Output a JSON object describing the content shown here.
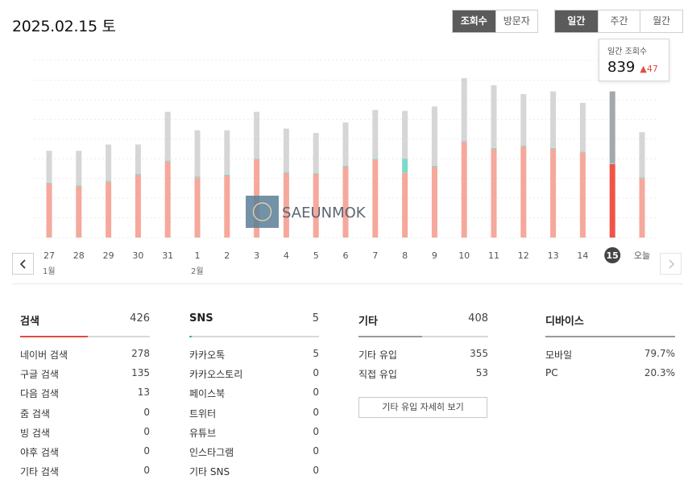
{
  "header": {
    "date": "2025.02.15 토"
  },
  "toggles": {
    "metric": [
      {
        "label": "조회수",
        "active": true
      },
      {
        "label": "방문자",
        "active": false
      }
    ],
    "period": [
      {
        "label": "일간",
        "active": true
      },
      {
        "label": "주간",
        "active": false
      },
      {
        "label": "월간",
        "active": false
      }
    ]
  },
  "tooltip": {
    "label": "일간 조회수",
    "value": "839",
    "delta": "▲47"
  },
  "watermark": "SAEUNMOK",
  "colors": {
    "search": "#f5a89c",
    "other": "#d6d6d6",
    "sns": "#7fd8cc",
    "selected_search": "#ef5448",
    "selected_other": "#a4a8ae",
    "accent_red": "#e44b3d"
  },
  "chart_data": {
    "type": "bar",
    "stacked": true,
    "categories": [
      "27",
      "28",
      "29",
      "30",
      "31",
      "1",
      "2",
      "3",
      "4",
      "5",
      "6",
      "7",
      "8",
      "9",
      "10",
      "11",
      "12",
      "13",
      "14",
      "15",
      "오늘"
    ],
    "month_labels": [
      {
        "at": "27",
        "label": "1월"
      },
      {
        "at": "1",
        "label": "2월"
      }
    ],
    "selected": "15",
    "series": [
      {
        "key": "search",
        "values": [
          305,
          290,
          315,
          355,
          430,
          340,
          350,
          440,
          365,
          360,
          400,
          440,
          365,
          400,
          540,
          500,
          515,
          500,
          480,
          415,
          335
        ]
      },
      {
        "key": "sns",
        "values": [
          5,
          5,
          5,
          5,
          5,
          5,
          5,
          5,
          5,
          5,
          5,
          5,
          80,
          5,
          5,
          5,
          5,
          5,
          5,
          5,
          5
        ]
      },
      {
        "key": "other",
        "values": [
          180,
          195,
          205,
          165,
          275,
          260,
          250,
          265,
          245,
          225,
          245,
          275,
          270,
          335,
          355,
          355,
          290,
          320,
          275,
          405,
          255
        ]
      }
    ],
    "ylim": [
      0,
      1000
    ],
    "grid": true
  },
  "stats": {
    "search": {
      "title": "검색",
      "total": "426",
      "fill": 0.52,
      "rows": [
        {
          "label": "네이버 검색",
          "value": "278"
        },
        {
          "label": "구글 검색",
          "value": "135"
        },
        {
          "label": "다음 검색",
          "value": "13"
        },
        {
          "label": "줌 검색",
          "value": "0"
        },
        {
          "label": "빙 검색",
          "value": "0"
        },
        {
          "label": "야후 검색",
          "value": "0"
        },
        {
          "label": "기타 검색",
          "value": "0"
        }
      ]
    },
    "sns": {
      "title": "SNS",
      "total": "5",
      "fill": 0.02,
      "rows": [
        {
          "label": "카카오톡",
          "value": "5"
        },
        {
          "label": "카카오스토리",
          "value": "0"
        },
        {
          "label": "페이스북",
          "value": "0"
        },
        {
          "label": "트위터",
          "value": "0"
        },
        {
          "label": "유튜브",
          "value": "0"
        },
        {
          "label": "인스타그램",
          "value": "0"
        },
        {
          "label": "기타 SNS",
          "value": "0"
        }
      ]
    },
    "other": {
      "title": "기타",
      "total": "408",
      "fill": 0.49,
      "rows": [
        {
          "label": "기타 유입",
          "value": "355"
        },
        {
          "label": "직접 유입",
          "value": "53"
        }
      ],
      "detail_button": "기타 유입 자세히 보기"
    },
    "device": {
      "title": "디바이스",
      "total": "",
      "fill": 1,
      "rows": [
        {
          "label": "모바일",
          "value": "79.7%"
        },
        {
          "label": "PC",
          "value": "20.3%"
        }
      ]
    }
  }
}
